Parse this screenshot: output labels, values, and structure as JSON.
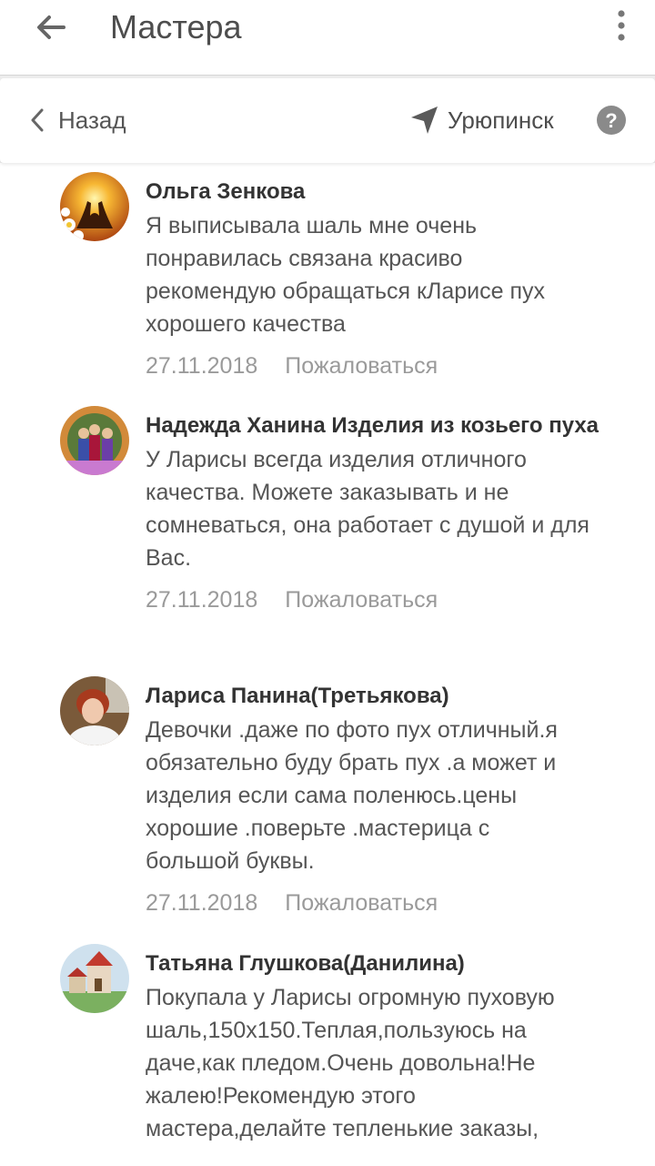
{
  "header": {
    "title": "Мастера"
  },
  "nav": {
    "back_label": "Назад",
    "location": "Урюпинск"
  },
  "comments": [
    {
      "author": "Ольга Зенкова",
      "text": "Я выписывала шаль мне очень понравилась связана красиво рекомендую обращаться кЛарисе пух хорошего качества",
      "date": "27.11.2018",
      "report": "Пожаловаться"
    },
    {
      "author": "Надежда Ханина Изделия из козьего пуха",
      "text": "У Ларисы всегда изделия отличного качества. Можете заказывать и не сомневаться, она работает с душой и для Вас.",
      "date": "27.11.2018",
      "report": "Пожаловаться"
    },
    {
      "author": "Лариса Панина(Третьякова)",
      "text": "Девочки .даже по фото пух отличный.я обязательно буду брать пух .а может и изделия если сама поленюсь.цены хорошие .поверьте .мастерица с большой буквы.",
      "date": "27.11.2018",
      "report": "Пожаловаться"
    },
    {
      "author": "Татьяна Глушкова(Данилина)",
      "text": "Покупала у Ларисы огромную пуховую шаль,150х150.Теплая,пользуюсь на даче,как пледом.Очень довольна!Не жалею!Рекомендую этого мастера,делайте тепленькие заказы,",
      "date": "",
      "report": ""
    }
  ]
}
